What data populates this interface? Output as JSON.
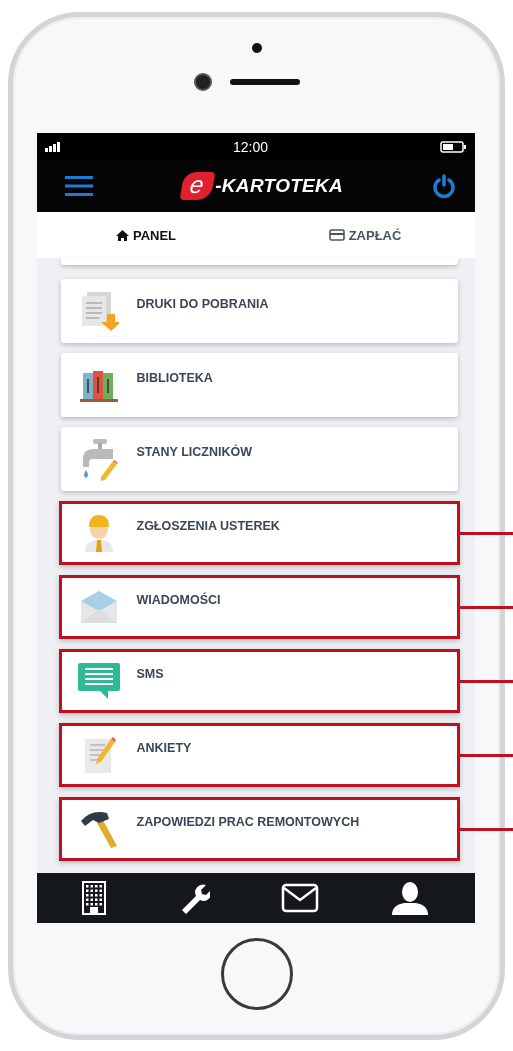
{
  "status_bar": {
    "time": "12:00"
  },
  "header": {
    "logo_mark": "e",
    "logo_text": "-KARTOTEKA"
  },
  "tabs": [
    {
      "label": "PANEL",
      "kind": "home",
      "selected": true
    },
    {
      "label": "ZAPŁAĆ",
      "kind": "card",
      "selected": false
    }
  ],
  "menu_items": [
    {
      "label": "DRUKI DO POBRANIA",
      "kind": "documents",
      "highlighted": false
    },
    {
      "label": "BIBLIOTEKA",
      "kind": "books",
      "highlighted": false
    },
    {
      "label": "STANY LICZNIKÓW",
      "kind": "tap",
      "highlighted": false
    },
    {
      "label": "ZGŁOSZENIA USTEREK",
      "kind": "worker",
      "highlighted": true
    },
    {
      "label": "WIADOMOŚCI",
      "kind": "envelope",
      "highlighted": true
    },
    {
      "label": "SMS",
      "kind": "chat",
      "highlighted": true
    },
    {
      "label": "ANKIETY",
      "kind": "survey",
      "highlighted": true
    },
    {
      "label": "ZAPOWIEDZI PRAC REMONTOWYCH",
      "kind": "hammer",
      "highlighted": true
    }
  ],
  "bottom_nav": [
    {
      "kind": "building"
    },
    {
      "kind": "wrench"
    },
    {
      "kind": "envelope"
    },
    {
      "kind": "person"
    }
  ]
}
